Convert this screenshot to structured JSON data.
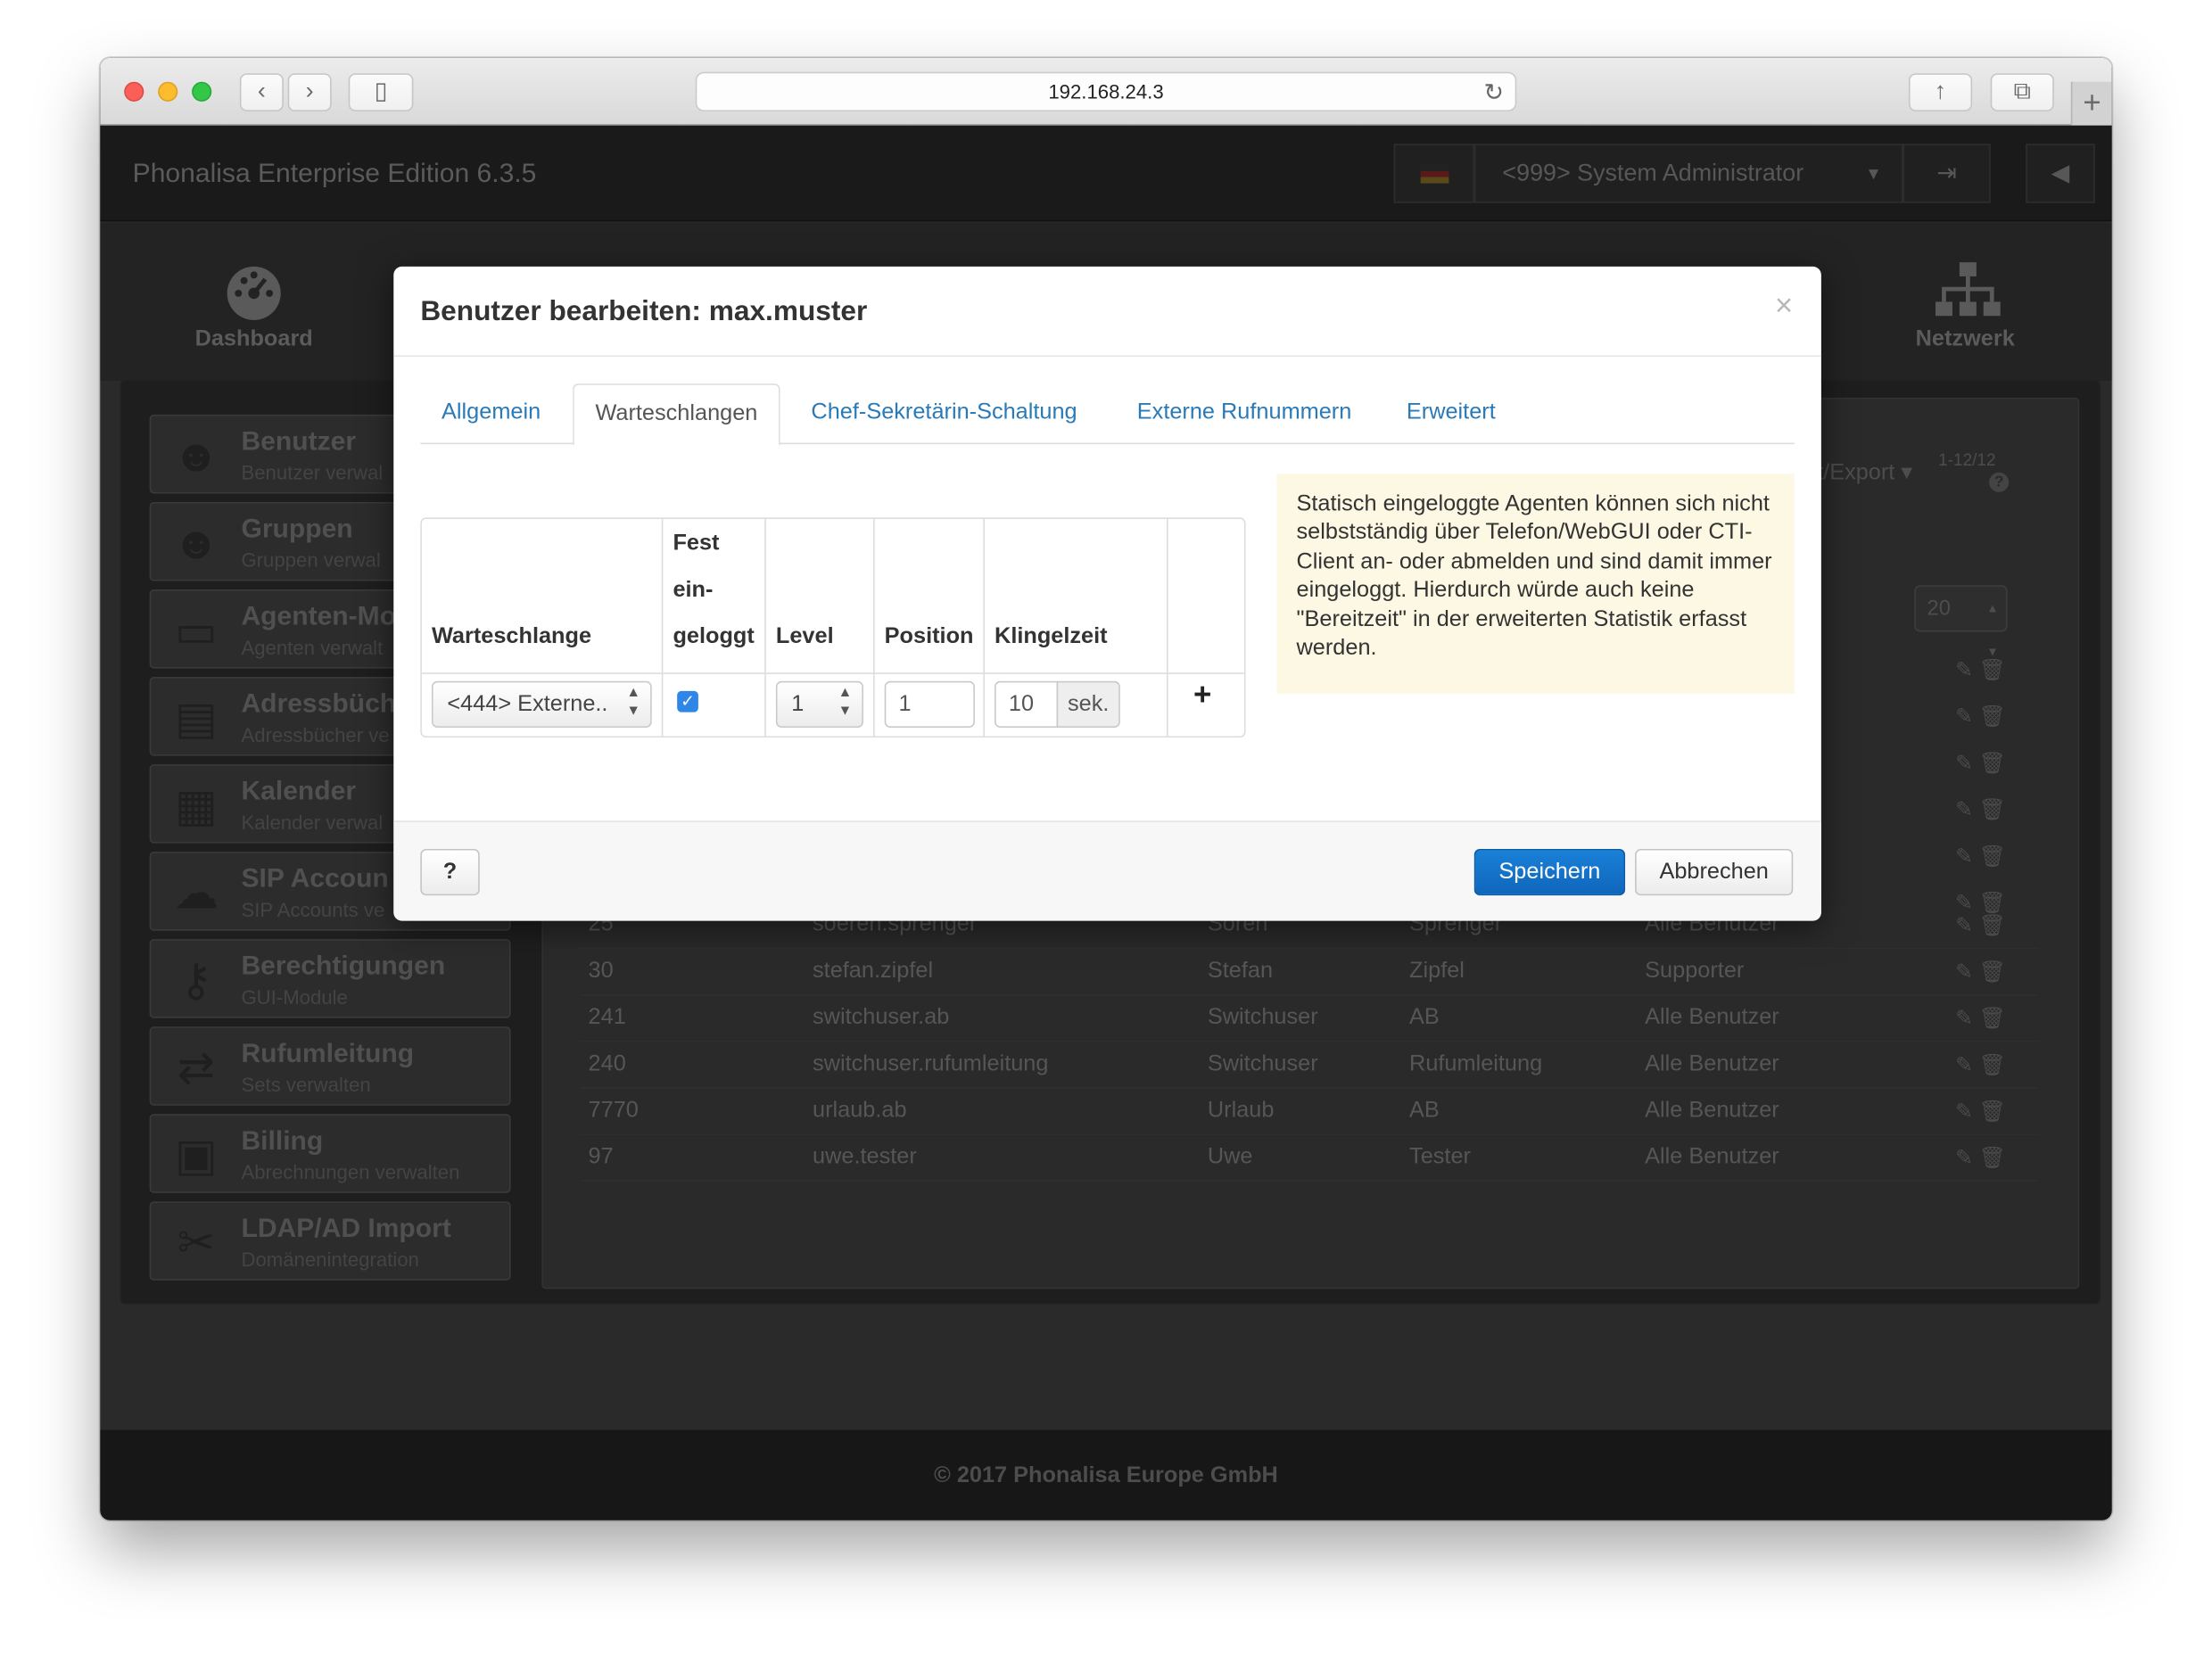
{
  "browser": {
    "url": "192.168.24.3"
  },
  "app": {
    "title": "Phonalisa Enterprise Edition 6.3.5",
    "user_menu": "<999> System Administrator",
    "footer": "© 2017 Phonalisa Europe GmbH"
  },
  "topnav": {
    "dashboard": "Dashboard",
    "network": "Netzwerk"
  },
  "sidebar": {
    "items": [
      {
        "title": "Benutzer",
        "subtitle": "Benutzer verwal"
      },
      {
        "title": "Gruppen",
        "subtitle": "Gruppen verwal"
      },
      {
        "title": "Agenten-Mo",
        "subtitle": "Agenten verwalt"
      },
      {
        "title": "Adressbüch",
        "subtitle": "Adressbücher ve"
      },
      {
        "title": "Kalender",
        "subtitle": "Kalender verwal"
      },
      {
        "title": "SIP Accoun",
        "subtitle": "SIP Accounts ve"
      },
      {
        "title": "Berechtigungen",
        "subtitle": "GUI-Module"
      },
      {
        "title": "Rufumleitung",
        "subtitle": "Sets verwalten"
      },
      {
        "title": "Billing",
        "subtitle": "Abrechnungen verwalten"
      },
      {
        "title": "LDAP/AD Import",
        "subtitle": "Domänenintegration"
      }
    ]
  },
  "main": {
    "import_export": "t/Export",
    "pager": "1-12/12",
    "page_size": "20",
    "rows": [
      {
        "ext": "25",
        "username": "soeren.sprenger",
        "first": "Sören",
        "last": "Sprenger",
        "group": "Alle Benutzer"
      },
      {
        "ext": "30",
        "username": "stefan.zipfel",
        "first": "Stefan",
        "last": "Zipfel",
        "group": "Supporter"
      },
      {
        "ext": "241",
        "username": "switchuser.ab",
        "first": "Switchuser",
        "last": "AB",
        "group": "Alle Benutzer"
      },
      {
        "ext": "240",
        "username": "switchuser.rufumleitung",
        "first": "Switchuser",
        "last": "Rufumleitung",
        "group": "Alle Benutzer"
      },
      {
        "ext": "7770",
        "username": "urlaub.ab",
        "first": "Urlaub",
        "last": "AB",
        "group": "Alle Benutzer"
      },
      {
        "ext": "97",
        "username": "uwe.tester",
        "first": "Uwe",
        "last": "Tester",
        "group": "Alle Benutzer"
      }
    ]
  },
  "modal": {
    "title": "Benutzer bearbeiten: max.muster",
    "close": "×",
    "tabs": [
      "Allgemein",
      "Warteschlangen",
      "Chef-Sekretärin-Schaltung",
      "Externe Rufnummern",
      "Erweitert"
    ],
    "active_tab": "Warteschlangen",
    "table": {
      "headers": {
        "queue": "Warteschlange",
        "fixed_line1": "Fest",
        "fixed_line2": "ein-",
        "fixed_line3": "geloggt",
        "level": "Level",
        "position": "Position",
        "ring_time": "Klingelzeit"
      },
      "row": {
        "queue": "<444> Externe..",
        "fixed_checked": true,
        "level": "1",
        "position": "1",
        "ring_time": "10",
        "ring_unit": "sek."
      },
      "add": "+"
    },
    "info": "Statisch eingeloggte Agenten können sich nicht selbstständig über Telefon/WebGUI oder CTI-Client an- oder abmelden und sind damit immer eingeloggt. Hierdurch würde auch keine \"Bereitzeit\" in der erweiterten Statistik erfasst werden.",
    "help": "?",
    "save": "Speichern",
    "cancel": "Abbrechen"
  },
  "colors": {
    "link": "#2a7ab8",
    "primary": "#1a80d8",
    "info_bg": "#fcf8e3"
  }
}
